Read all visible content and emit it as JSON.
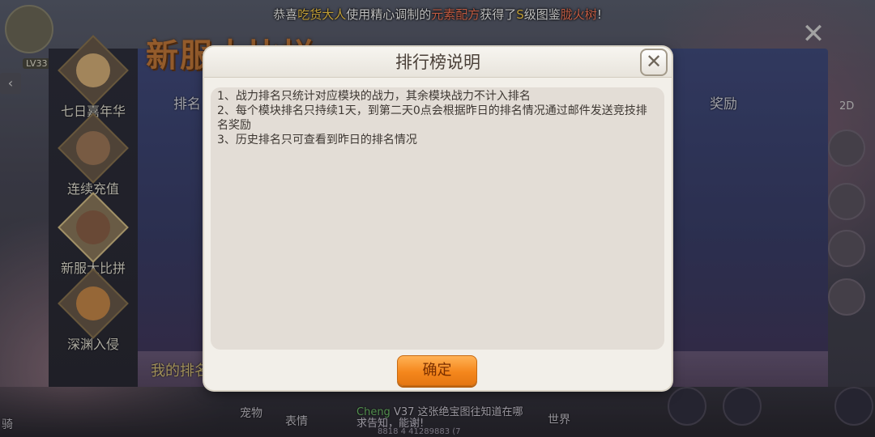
{
  "background": {
    "broadcast": {
      "part1": "恭喜",
      "player": "吃货大人",
      "part2": "使用精心调制的",
      "item": "元素配方",
      "part3": "获得了",
      "grade": "S",
      "part4": "级图鉴",
      "reward": "胧火树",
      "part5": "!"
    },
    "level_badge": "LV33",
    "event_title": "新服大比拼",
    "menu": [
      {
        "label": "七日嘉年华"
      },
      {
        "label": "连续充值"
      },
      {
        "label": "新服大比拼"
      },
      {
        "label": "深渊入侵"
      }
    ],
    "columns": {
      "rank": "排名",
      "reward": "奖励"
    },
    "my_rank_label": "我的排名",
    "right_rail_label": "2D",
    "bottom": {
      "left_label": "骑",
      "pet": "宠物",
      "emote": "表情",
      "world": "世界"
    },
    "chat": {
      "name": "Cheng",
      "line": "V37 这张绝宝图往知道在哪",
      "sub": "求告知，能谢!",
      "coords": "8818 4 41289883 (7"
    }
  },
  "modal": {
    "title": "排行榜说明",
    "close_symbol": "✕",
    "rules": [
      "1、战力排名只统计对应模块的战力，其余模块战力不计入排名",
      "2、每个模块排名只持续1天，到第二天0点会根据昨日的排名情况通过邮件发送竞技排名奖励",
      "3、历史排名只可查看到昨日的排名情况"
    ],
    "confirm_label": "确定"
  },
  "colors": {
    "accent_orange": "#f5871c",
    "modal_bg": "#f2efe9",
    "content_bg": "#e3ddd6",
    "text_dark": "#3e3833"
  },
  "icons": [
    "close-icon",
    "back-arrow-icon",
    "avatar-icon"
  ]
}
